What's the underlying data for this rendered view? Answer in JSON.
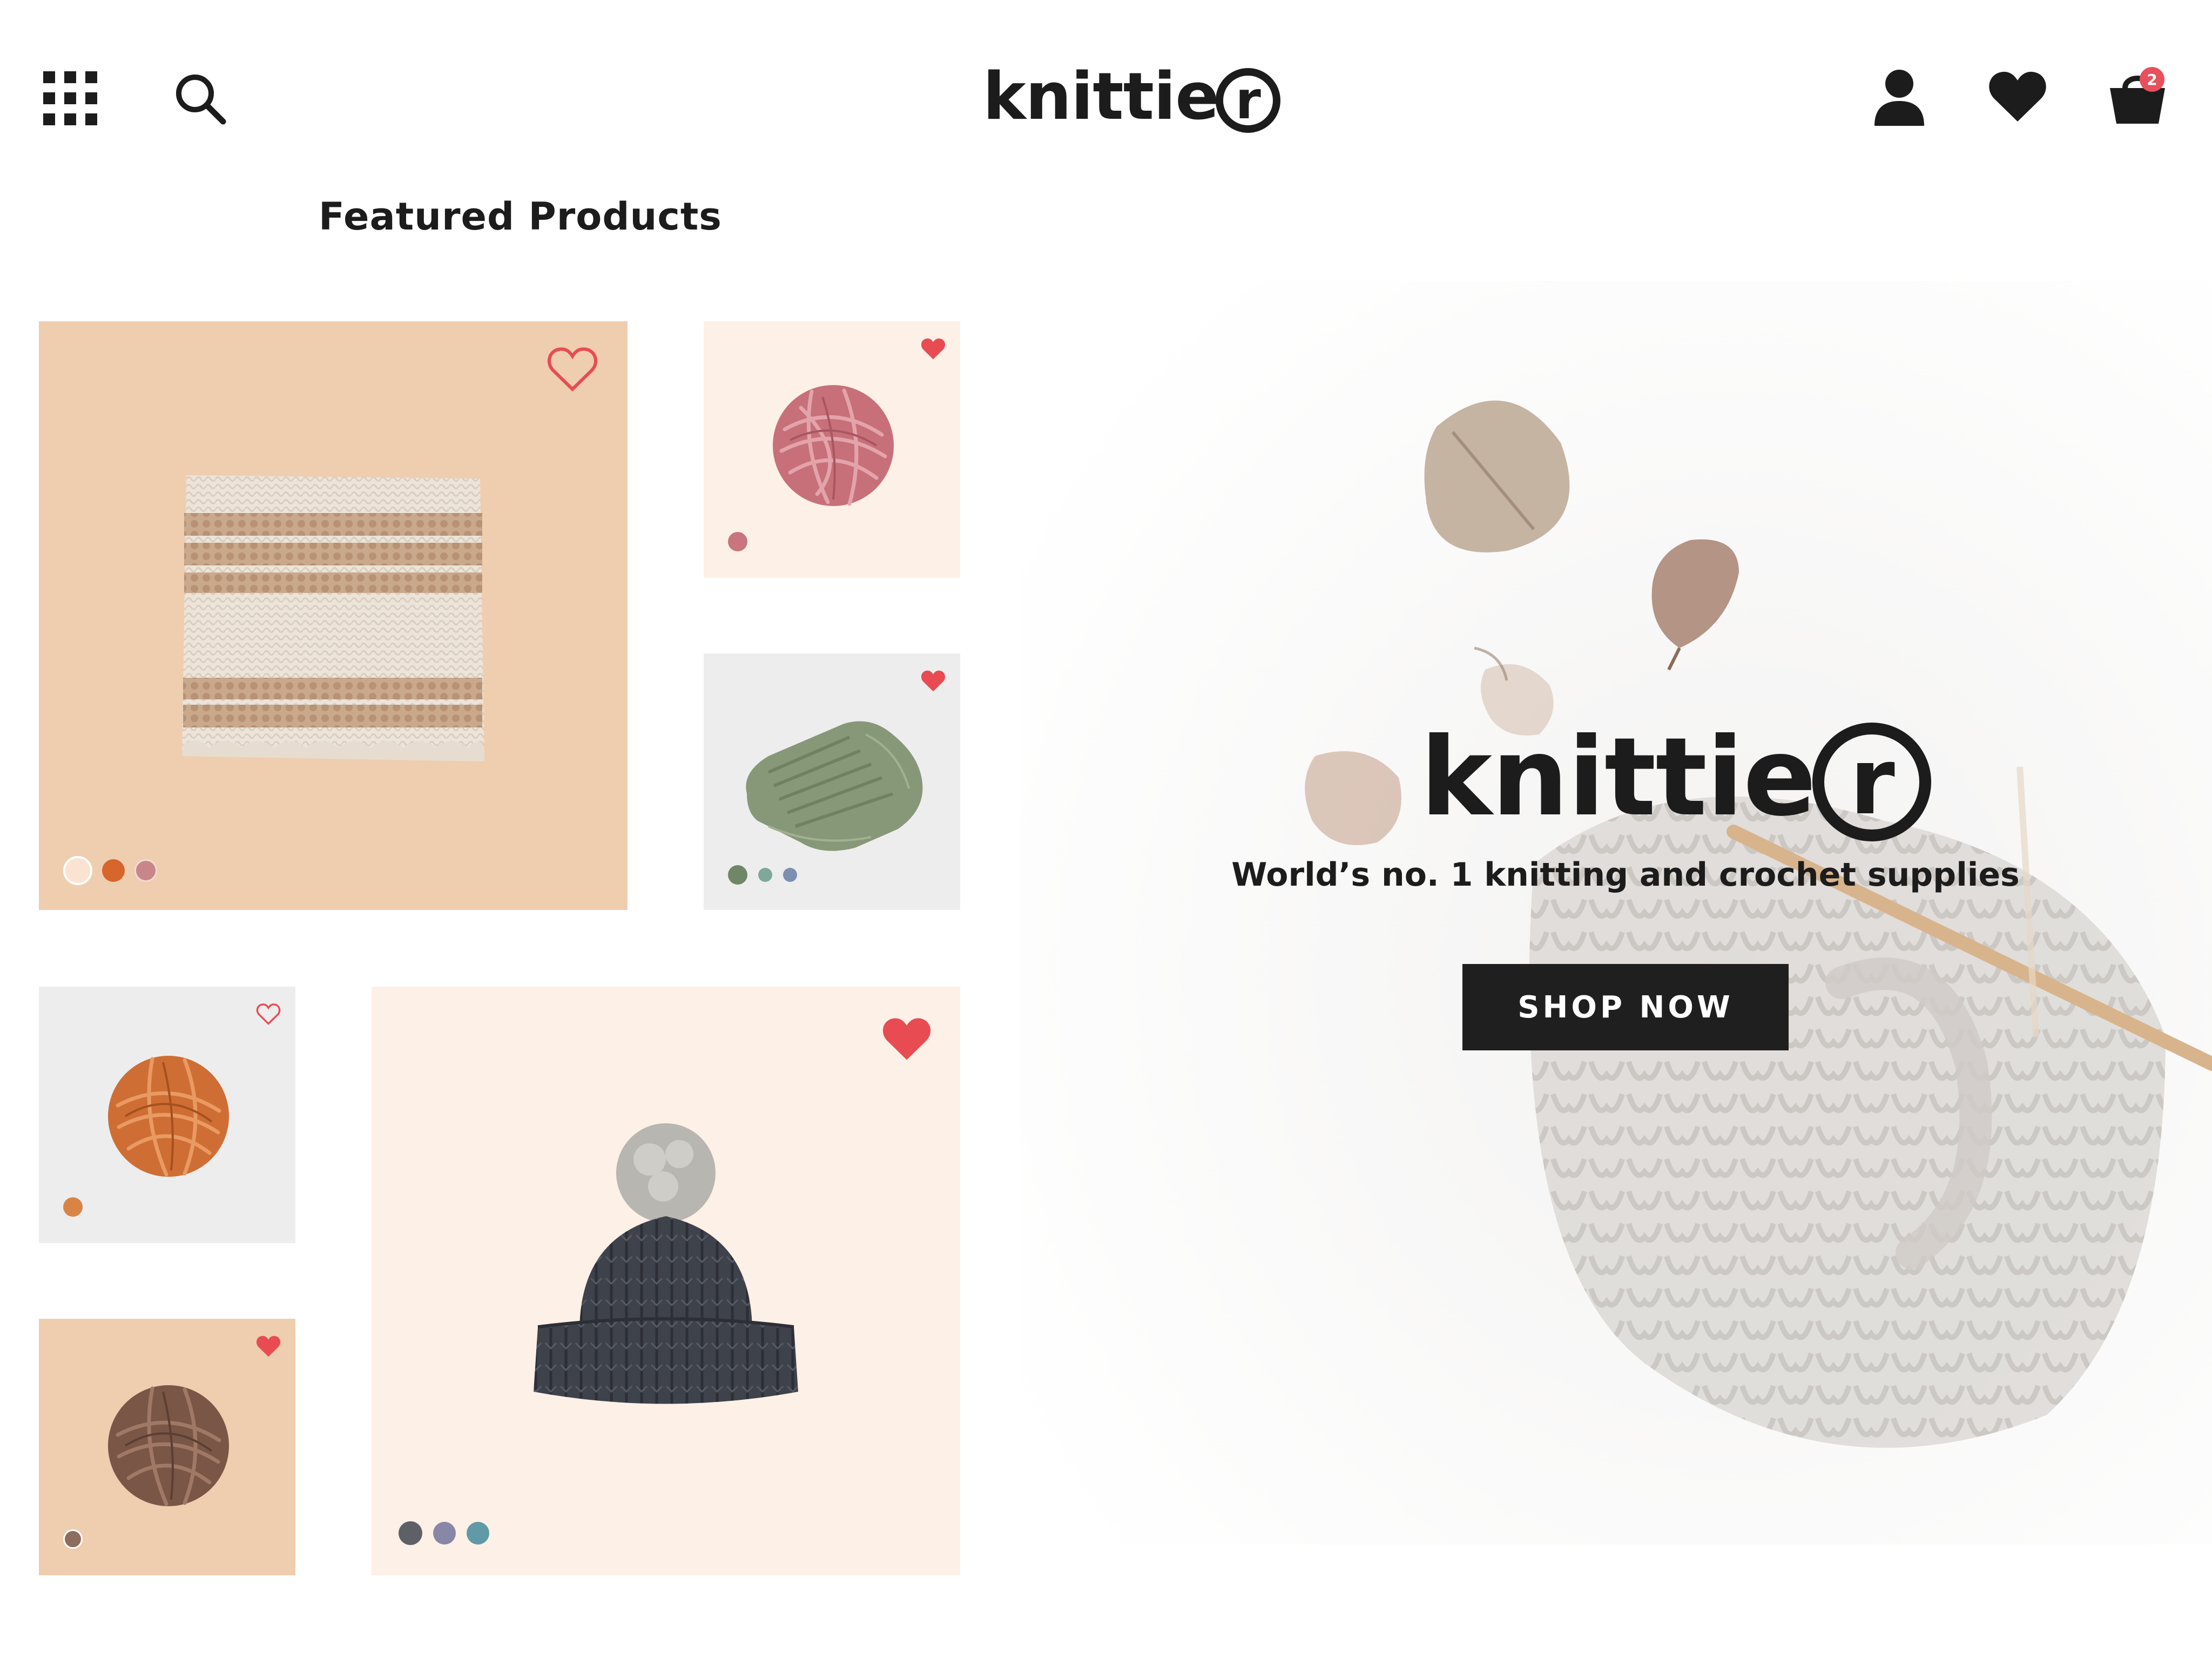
{
  "header": {
    "logo_text": "knitti",
    "logo_e": "e",
    "logo_r": "r",
    "cart_count": "2",
    "icons": [
      "grid-menu-icon",
      "search-icon",
      "user-icon",
      "heart-icon",
      "shopping-bag-icon"
    ]
  },
  "section_title": "Featured Products",
  "products": [
    {
      "name": "striped crochet cowl",
      "favorited": false,
      "swatches": [
        "#fbe3d2",
        "#d6662c",
        "#c98688"
      ]
    },
    {
      "name": "pink yarn ball",
      "favorited": true,
      "swatches": [
        "#c8757d"
      ]
    },
    {
      "name": "green knit blanket",
      "favorited": true,
      "swatches": [
        "#6f8766",
        "#7fa89a",
        "#7b8fb0"
      ]
    },
    {
      "name": "orange yarn ball",
      "favorited": false,
      "swatches": [
        "#d98447"
      ]
    },
    {
      "name": "black pom-pom beanie",
      "favorited": true,
      "swatches": [
        "#5e6068",
        "#8887a8",
        "#5f9aa6"
      ]
    },
    {
      "name": "brown yarn ball",
      "favorited": true,
      "swatches": [
        "#8d6d5e"
      ]
    }
  ],
  "hero": {
    "logo_text": "knitti",
    "logo_e": "e",
    "logo_r": "r",
    "tagline": "World’s no. 1 knitting and crochet supplies",
    "cta": "SHOP NOW"
  },
  "colors": {
    "accent_heart": "#e84c52",
    "dark": "#1c1c1c",
    "tile_peach": "#efcdaf",
    "tile_cream": "#fdf0e6",
    "tile_grey": "#ededed"
  }
}
